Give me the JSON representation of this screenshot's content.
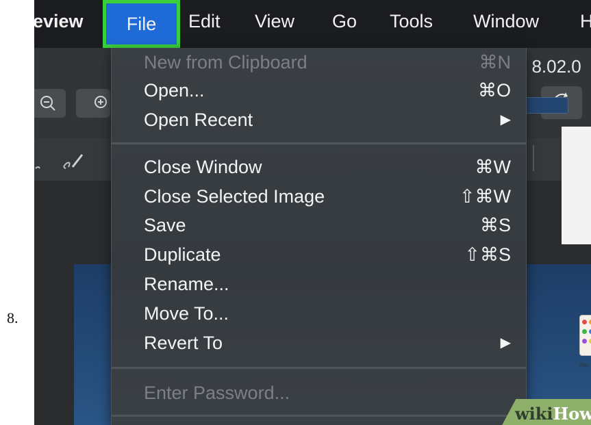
{
  "step_number": "8.",
  "menubar": {
    "app_name": "eview",
    "items": [
      "File",
      "Edit",
      "View",
      "Go",
      "Tools",
      "Window",
      "H"
    ]
  },
  "window": {
    "title_fragment": "t 8.02.0"
  },
  "file_menu": {
    "items": [
      {
        "label": "New from Clipboard",
        "shortcut": "⌘N",
        "enabled": false
      },
      {
        "label": "Open...",
        "shortcut": "⌘O",
        "enabled": true
      },
      {
        "label": "Open Recent",
        "shortcut": "▶",
        "enabled": true
      },
      {
        "label": "Close Window",
        "shortcut": "⌘W",
        "enabled": true
      },
      {
        "label": "Close Selected Image",
        "shortcut": "⇧⌘W",
        "enabled": true
      },
      {
        "label": "Save",
        "shortcut": "⌘S",
        "enabled": true
      },
      {
        "label": "Duplicate",
        "shortcut": "⇧⌘S",
        "enabled": true
      },
      {
        "label": "Rename...",
        "shortcut": "",
        "enabled": true
      },
      {
        "label": "Move To...",
        "shortcut": "",
        "enabled": true
      },
      {
        "label": "Revert To",
        "shortcut": "▶",
        "enabled": true
      },
      {
        "label": "Enter Password...",
        "shortcut": "",
        "enabled": false
      }
    ]
  },
  "document": {
    "icon_label": "Ren"
  },
  "watermark": {
    "part1": "wiki",
    "part2": "How"
  },
  "colors": {
    "highlight_border": "#3bd03b",
    "menu_selected": "#1e6ad6"
  }
}
